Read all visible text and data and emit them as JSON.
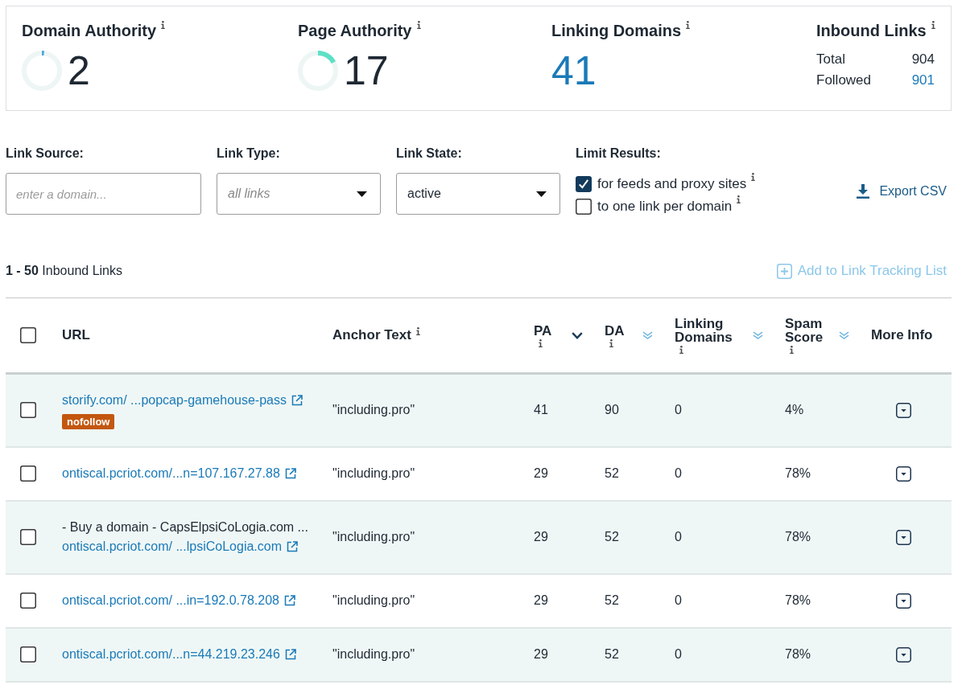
{
  "metrics": [
    {
      "kind": "gauge",
      "title": "Domain Authority",
      "info": true,
      "value": "2",
      "level": 0.02,
      "color": "#4aa8de"
    },
    {
      "kind": "gauge",
      "title": "Page Authority",
      "info": true,
      "value": "17",
      "level": 0.17,
      "color": "#5ee0c6"
    },
    {
      "kind": "number",
      "title": "Linking Domains",
      "info": true,
      "value": "41",
      "link": true
    },
    {
      "kind": "breakdown",
      "title": "Inbound Links",
      "info": true,
      "rows": [
        {
          "label": "Total",
          "value": "904",
          "link": false
        },
        {
          "label": "Followed",
          "value": "901",
          "link": true
        }
      ]
    }
  ],
  "filters": [
    {
      "kind": "text",
      "label": "Link Source:",
      "placeholder": "enter a domain..."
    },
    {
      "kind": "select",
      "label": "Link Type:",
      "placeholder": "all links"
    },
    {
      "kind": "select",
      "label": "Link State:",
      "value": "active"
    },
    {
      "kind": "checks",
      "label": "Limit Results:",
      "options": [
        {
          "label": "for feeds and proxy sites",
          "checked": true,
          "info": true
        },
        {
          "label": "to one link per domain",
          "checked": false,
          "info": true
        }
      ]
    }
  ],
  "export_button": {
    "label": "Export CSV"
  },
  "results": {
    "summary": "**1 - 50** Inbound Links",
    "tracking_button": {
      "label": "Add to Link Tracking List",
      "disabled": true
    }
  },
  "table": {
    "header_checkbox": {
      "checked": false
    },
    "columns": [
      {
        "label": "URL",
        "info": false
      },
      {
        "label": "Anchor Text",
        "info": true
      },
      {
        "label": "PA",
        "info": true,
        "sortable": true,
        "sorted": true
      },
      {
        "label": "DA",
        "info": true,
        "sortable": true,
        "sorted": false
      },
      {
        "label": "Linking Domains",
        "info": true,
        "sortable": true,
        "sorted": false
      },
      {
        "label": "Spam Score",
        "info": true,
        "sortable": true,
        "sorted": false
      },
      {
        "label": "More Info",
        "info": false
      }
    ],
    "rows": [
      {
        "checked": false,
        "url": "storify.com/ ...popcap-gamehouse-pass",
        "badge": "nofollow",
        "anchor": "\"including.pro\"",
        "pa": "41",
        "da": "90",
        "linking_domains": "0",
        "spam_score": "4%"
      },
      {
        "checked": false,
        "url": "ontiscal.pcriot.com/...n=107.167.27.88",
        "anchor": "\"including.pro\"",
        "pa": "29",
        "da": "52",
        "linking_domains": "0",
        "spam_score": "78%"
      },
      {
        "checked": false,
        "title": "- Buy a domain - CapsElpsiCoLogia.com ...",
        "url": "ontiscal.pcriot.com/ ...lpsiCoLogia.com",
        "anchor": "\"including.pro\"",
        "pa": "29",
        "da": "52",
        "linking_domains": "0",
        "spam_score": "78%"
      },
      {
        "checked": false,
        "url": "ontiscal.pcriot.com/ ...in=192.0.78.208",
        "anchor": "\"including.pro\"",
        "pa": "29",
        "da": "52",
        "linking_domains": "0",
        "spam_score": "78%"
      },
      {
        "checked": false,
        "url": "ontiscal.pcriot.com/...n=44.219.23.246",
        "anchor": "\"including.pro\"",
        "pa": "29",
        "da": "52",
        "linking_domains": "0",
        "spam_score": "78%"
      }
    ]
  }
}
